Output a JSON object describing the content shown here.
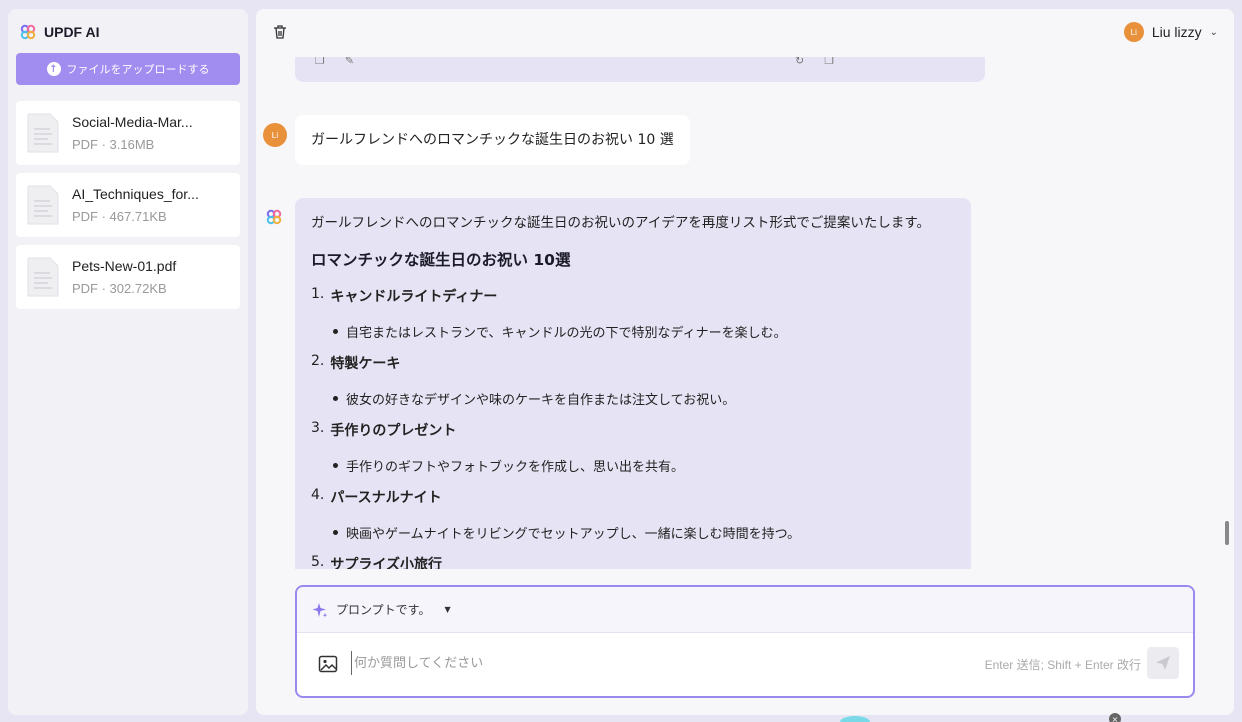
{
  "brand": {
    "name": "UPDF AI"
  },
  "sidebar": {
    "upload_label": "ファイルをアップロードする",
    "files": [
      {
        "name": "Social-Media-Mar...",
        "meta": "PDF · 3.16MB"
      },
      {
        "name": "AI_Techniques_for...",
        "meta": "PDF · 467.71KB"
      },
      {
        "name": "Pets-New-01.pdf",
        "meta": "PDF · 302.72KB"
      }
    ]
  },
  "header": {
    "user_initials": "Li",
    "user_name": "Liu lizzy"
  },
  "chat": {
    "user_message": "ガールフレンドへのロマンチックな誕生日のお祝い 10 選",
    "ai_intro": "ガールフレンドへのロマンチックな誕生日のお祝いのアイデアを再度リスト形式でご提案いたします。",
    "ai_heading": "ロマンチックな誕生日のお祝い 10選",
    "items": [
      {
        "num": "1.",
        "title": "キャンドルライトディナー",
        "detail": "自宅またはレストランで、キャンドルの光の下で特別なディナーを楽しむ。"
      },
      {
        "num": "2.",
        "title": "特製ケーキ",
        "detail": "彼女の好きなデザインや味のケーキを自作または注文してお祝い。"
      },
      {
        "num": "3.",
        "title": "手作りのプレゼント",
        "detail": "手作りのギフトやフォトブックを作成し、思い出を共有。"
      },
      {
        "num": "4.",
        "title": "パースナルナイト",
        "detail": "映画やゲームナイトをリビングでセットアップし、一緒に楽しむ時間を持つ。"
      },
      {
        "num": "5.",
        "title": "サプライズ小旅行",
        "detail": ""
      }
    ]
  },
  "composer": {
    "prompt_label": "プロンプトです。",
    "input_placeholder": "何か質問してください",
    "hint": "Enter 送信; Shift + Enter 改行"
  },
  "colors": {
    "accent": "#9a89ee",
    "upload_button": "#a18cf0",
    "ai_bubble": "#e6e4f4",
    "avatar": "#e8903a"
  }
}
